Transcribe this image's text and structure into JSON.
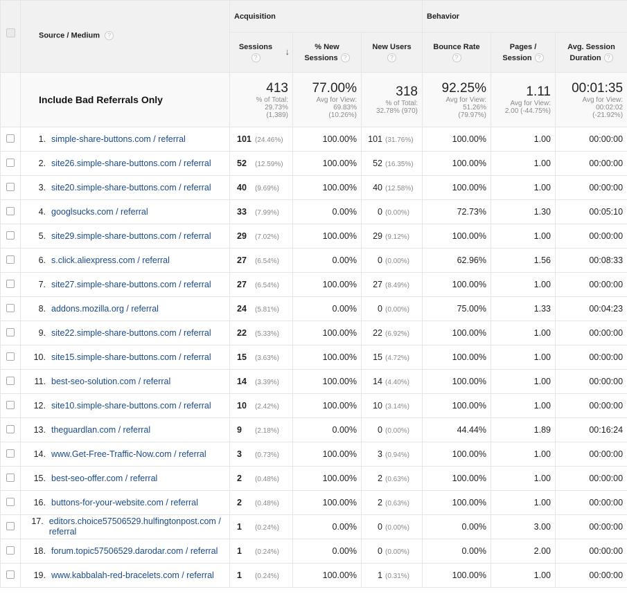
{
  "header": {
    "source_medium": "Source / Medium",
    "acquisition": "Acquisition",
    "behavior": "Behavior",
    "columns": {
      "sessions": "Sessions",
      "new_sessions_1": "% New",
      "new_sessions_2": "Sessions",
      "new_users": "New Users",
      "bounce_rate": "Bounce Rate",
      "pages_1": "Pages /",
      "pages_2": "Session",
      "duration_1": "Avg. Session",
      "duration_2": "Duration"
    },
    "help_glyph": "?",
    "sort_glyph": "↓"
  },
  "totals": {
    "label": "Include Bad Referrals Only",
    "sessions": {
      "value": "413",
      "l1": "% of Total:",
      "l2": "29.73%",
      "l3": "(1,389)"
    },
    "new_sessions": {
      "value": "77.00%",
      "l1": "Avg for View:",
      "l2": "69.83%",
      "l3": "(10.26%)"
    },
    "new_users": {
      "value": "318",
      "l1": "% of Total:",
      "l2": "32.78% (970)",
      "l3": ""
    },
    "bounce_rate": {
      "value": "92.25%",
      "l1": "Avg for View:",
      "l2": "51.26%",
      "l3": "(79.97%)"
    },
    "pages": {
      "value": "1.11",
      "l1": "Avg for View:",
      "l2": "2.00 (-44.75%)",
      "l3": ""
    },
    "duration": {
      "value": "00:01:35",
      "l1": "Avg for View:",
      "l2": "00:02:02",
      "l3": "(-21.92%)"
    }
  },
  "rows": [
    {
      "idx": "1.",
      "source": "simple-share-buttons.com / referral",
      "sessions": "101",
      "sessions_pct": "(24.46%)",
      "new_sessions": "100.00%",
      "new_users": "101",
      "new_users_pct": "(31.76%)",
      "bounce": "100.00%",
      "pages": "1.00",
      "duration": "00:00:00"
    },
    {
      "idx": "2.",
      "source": "site26.simple-share-buttons.com / referral",
      "sessions": "52",
      "sessions_pct": "(12.59%)",
      "new_sessions": "100.00%",
      "new_users": "52",
      "new_users_pct": "(16.35%)",
      "bounce": "100.00%",
      "pages": "1.00",
      "duration": "00:00:00"
    },
    {
      "idx": "3.",
      "source": "site20.simple-share-buttons.com / referral",
      "sessions": "40",
      "sessions_pct": "(9.69%)",
      "new_sessions": "100.00%",
      "new_users": "40",
      "new_users_pct": "(12.58%)",
      "bounce": "100.00%",
      "pages": "1.00",
      "duration": "00:00:00"
    },
    {
      "idx": "4.",
      "source": "googlsucks.com / referral",
      "sessions": "33",
      "sessions_pct": "(7.99%)",
      "new_sessions": "0.00%",
      "new_users": "0",
      "new_users_pct": "(0.00%)",
      "bounce": "72.73%",
      "pages": "1.30",
      "duration": "00:05:10"
    },
    {
      "idx": "5.",
      "source": "site29.simple-share-buttons.com / referral",
      "sessions": "29",
      "sessions_pct": "(7.02%)",
      "new_sessions": "100.00%",
      "new_users": "29",
      "new_users_pct": "(9.12%)",
      "bounce": "100.00%",
      "pages": "1.00",
      "duration": "00:00:00"
    },
    {
      "idx": "6.",
      "source": "s.click.aliexpress.com / referral",
      "sessions": "27",
      "sessions_pct": "(6.54%)",
      "new_sessions": "0.00%",
      "new_users": "0",
      "new_users_pct": "(0.00%)",
      "bounce": "62.96%",
      "pages": "1.56",
      "duration": "00:08:33"
    },
    {
      "idx": "7.",
      "source": "site27.simple-share-buttons.com / referral",
      "sessions": "27",
      "sessions_pct": "(6.54%)",
      "new_sessions": "100.00%",
      "new_users": "27",
      "new_users_pct": "(8.49%)",
      "bounce": "100.00%",
      "pages": "1.00",
      "duration": "00:00:00"
    },
    {
      "idx": "8.",
      "source": "addons.mozilla.org / referral",
      "sessions": "24",
      "sessions_pct": "(5.81%)",
      "new_sessions": "0.00%",
      "new_users": "0",
      "new_users_pct": "(0.00%)",
      "bounce": "75.00%",
      "pages": "1.33",
      "duration": "00:04:23"
    },
    {
      "idx": "9.",
      "source": "site22.simple-share-buttons.com / referral",
      "sessions": "22",
      "sessions_pct": "(5.33%)",
      "new_sessions": "100.00%",
      "new_users": "22",
      "new_users_pct": "(6.92%)",
      "bounce": "100.00%",
      "pages": "1.00",
      "duration": "00:00:00"
    },
    {
      "idx": "10.",
      "source": "site15.simple-share-buttons.com / referral",
      "sessions": "15",
      "sessions_pct": "(3.63%)",
      "new_sessions": "100.00%",
      "new_users": "15",
      "new_users_pct": "(4.72%)",
      "bounce": "100.00%",
      "pages": "1.00",
      "duration": "00:00:00"
    },
    {
      "idx": "11.",
      "source": "best-seo-solution.com / referral",
      "sessions": "14",
      "sessions_pct": "(3.39%)",
      "new_sessions": "100.00%",
      "new_users": "14",
      "new_users_pct": "(4.40%)",
      "bounce": "100.00%",
      "pages": "1.00",
      "duration": "00:00:00"
    },
    {
      "idx": "12.",
      "source": "site10.simple-share-buttons.com / referral",
      "sessions": "10",
      "sessions_pct": "(2.42%)",
      "new_sessions": "100.00%",
      "new_users": "10",
      "new_users_pct": "(3.14%)",
      "bounce": "100.00%",
      "pages": "1.00",
      "duration": "00:00:00"
    },
    {
      "idx": "13.",
      "source": "theguardlan.com / referral",
      "sessions": "9",
      "sessions_pct": "(2.18%)",
      "new_sessions": "0.00%",
      "new_users": "0",
      "new_users_pct": "(0.00%)",
      "bounce": "44.44%",
      "pages": "1.89",
      "duration": "00:16:24"
    },
    {
      "idx": "14.",
      "source": "www.Get-Free-Traffic-Now.com / referral",
      "sessions": "3",
      "sessions_pct": "(0.73%)",
      "new_sessions": "100.00%",
      "new_users": "3",
      "new_users_pct": "(0.94%)",
      "bounce": "100.00%",
      "pages": "1.00",
      "duration": "00:00:00"
    },
    {
      "idx": "15.",
      "source": "best-seo-offer.com / referral",
      "sessions": "2",
      "sessions_pct": "(0.48%)",
      "new_sessions": "100.00%",
      "new_users": "2",
      "new_users_pct": "(0.63%)",
      "bounce": "100.00%",
      "pages": "1.00",
      "duration": "00:00:00"
    },
    {
      "idx": "16.",
      "source": "buttons-for-your-website.com / referral",
      "sessions": "2",
      "sessions_pct": "(0.48%)",
      "new_sessions": "100.00%",
      "new_users": "2",
      "new_users_pct": "(0.63%)",
      "bounce": "100.00%",
      "pages": "1.00",
      "duration": "00:00:00"
    },
    {
      "idx": "17.",
      "source": "editors.choice57506529.hulfingtonpost.com / referral",
      "sessions": "1",
      "sessions_pct": "(0.24%)",
      "new_sessions": "0.00%",
      "new_users": "0",
      "new_users_pct": "(0.00%)",
      "bounce": "0.00%",
      "pages": "3.00",
      "duration": "00:00:00"
    },
    {
      "idx": "18.",
      "source": "forum.topic57506529.darodar.com / referral",
      "sessions": "1",
      "sessions_pct": "(0.24%)",
      "new_sessions": "0.00%",
      "new_users": "0",
      "new_users_pct": "(0.00%)",
      "bounce": "0.00%",
      "pages": "2.00",
      "duration": "00:00:00"
    },
    {
      "idx": "19.",
      "source": "www.kabbalah-red-bracelets.com / referral",
      "sessions": "1",
      "sessions_pct": "(0.24%)",
      "new_sessions": "100.00%",
      "new_users": "1",
      "new_users_pct": "(0.31%)",
      "bounce": "100.00%",
      "pages": "1.00",
      "duration": "00:00:00"
    }
  ]
}
